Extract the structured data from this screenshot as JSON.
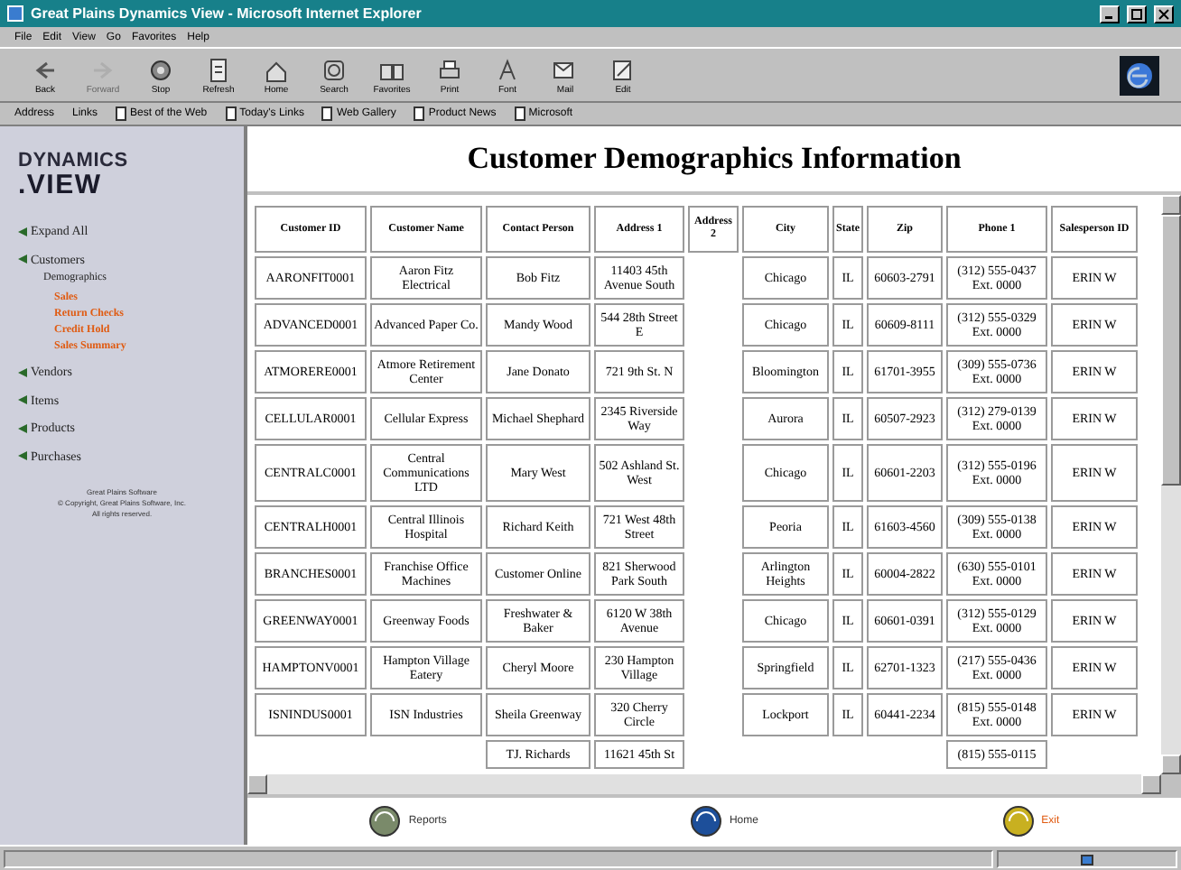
{
  "window": {
    "title": "Great Plains Dynamics View - Microsoft Internet Explorer"
  },
  "menu": [
    "File",
    "Edit",
    "View",
    "Go",
    "Favorites",
    "Help"
  ],
  "toolbar": [
    {
      "label": "Back",
      "disabled": false
    },
    {
      "label": "Forward",
      "disabled": true
    },
    {
      "label": "Stop",
      "disabled": false
    },
    {
      "label": "Refresh",
      "disabled": false
    },
    {
      "label": "Home",
      "disabled": false
    },
    {
      "label": "Search",
      "disabled": false
    },
    {
      "label": "Favorites",
      "disabled": false
    },
    {
      "label": "Print",
      "disabled": false
    },
    {
      "label": "Font",
      "disabled": false
    },
    {
      "label": "Mail",
      "disabled": false
    },
    {
      "label": "Edit",
      "disabled": false
    }
  ],
  "links_bar": {
    "address_label": "Address",
    "links_label": "Links",
    "links": [
      "Best of the Web",
      "Today's Links",
      "Web Gallery",
      "Product News",
      "Microsoft"
    ]
  },
  "sidebar": {
    "logo_top": "DYNAMICS",
    "logo_bottom": ".VIEW",
    "items": [
      {
        "label": "Expand All"
      },
      {
        "label": "Customers",
        "children": [
          {
            "label": "Demographics",
            "selected": true
          },
          {
            "label": "Sales",
            "selected": false
          },
          {
            "label": "Return Checks",
            "selected": false
          },
          {
            "label": "Credit Hold",
            "selected": false
          },
          {
            "label": "Sales Summary",
            "selected": false
          }
        ]
      },
      {
        "label": "Vendors"
      },
      {
        "label": "Items"
      },
      {
        "label": "Products"
      },
      {
        "label": "Purchases"
      }
    ],
    "footer": [
      "Great Plains Software",
      "© Copyright, Great Plains Software, Inc.",
      "All rights reserved."
    ]
  },
  "page_title": "Customer Demographics Information",
  "table": {
    "columns": [
      "Customer ID",
      "Customer Name",
      "Contact Person",
      "Address 1",
      "Address 2",
      "City",
      "State",
      "Zip",
      "Phone 1",
      "Salesperson ID"
    ],
    "rows": [
      [
        "AARONFIT0001",
        "Aaron Fitz Electrical",
        "Bob Fitz",
        "11403 45th Avenue South",
        "",
        "Chicago",
        "IL",
        "60603-2791",
        "(312) 555-0437 Ext. 0000",
        "ERIN W"
      ],
      [
        "ADVANCED0001",
        "Advanced Paper Co.",
        "Mandy Wood",
        "544 28th Street E",
        "",
        "Chicago",
        "IL",
        "60609-8111",
        "(312) 555-0329 Ext. 0000",
        "ERIN W"
      ],
      [
        "ATMORERE0001",
        "Atmore Retirement Center",
        "Jane Donato",
        "721 9th St. N",
        "",
        "Bloomington",
        "IL",
        "61701-3955",
        "(309) 555-0736 Ext. 0000",
        "ERIN W"
      ],
      [
        "CELLULAR0001",
        "Cellular Express",
        "Michael Shephard",
        "2345 Riverside Way",
        "",
        "Aurora",
        "IL",
        "60507-2923",
        "(312) 279-0139 Ext. 0000",
        "ERIN W"
      ],
      [
        "CENTRALC0001",
        "Central Communications LTD",
        "Mary West",
        "502 Ashland St. West",
        "",
        "Chicago",
        "IL",
        "60601-2203",
        "(312) 555-0196 Ext. 0000",
        "ERIN W"
      ],
      [
        "CENTRALH0001",
        "Central Illinois Hospital",
        "Richard Keith",
        "721 West 48th Street",
        "",
        "Peoria",
        "IL",
        "61603-4560",
        "(309) 555-0138 Ext. 0000",
        "ERIN W"
      ],
      [
        "BRANCHES0001",
        "Franchise Office Machines",
        "Customer Online",
        "821 Sherwood Park South",
        "",
        "Arlington Heights",
        "IL",
        "60004-2822",
        "(630) 555-0101 Ext. 0000",
        "ERIN W"
      ],
      [
        "GREENWAY0001",
        "Greenway Foods",
        "Freshwater & Baker",
        "6120 W 38th Avenue",
        "",
        "Chicago",
        "IL",
        "60601-0391",
        "(312) 555-0129 Ext. 0000",
        "ERIN W"
      ],
      [
        "HAMPTONV0001",
        "Hampton Village Eatery",
        "Cheryl Moore",
        "230 Hampton Village",
        "",
        "Springfield",
        "IL",
        "62701-1323",
        "(217) 555-0436 Ext. 0000",
        "ERIN W"
      ],
      [
        "ISNINDUS0001",
        "ISN Industries",
        "Sheila Greenway",
        "320 Cherry Circle",
        "",
        "Lockport",
        "IL",
        "60441-2234",
        "(815) 555-0148 Ext. 0000",
        "ERIN W"
      ],
      [
        "",
        "",
        "TJ. Richards",
        "11621 45th St",
        "",
        "",
        "",
        "",
        "(815) 555-0115",
        ""
      ]
    ]
  },
  "bottom_buttons": [
    {
      "label": "Reports",
      "highlighted": false
    },
    {
      "label": "Home",
      "highlighted": false
    },
    {
      "label": "Exit",
      "highlighted": true
    }
  ]
}
